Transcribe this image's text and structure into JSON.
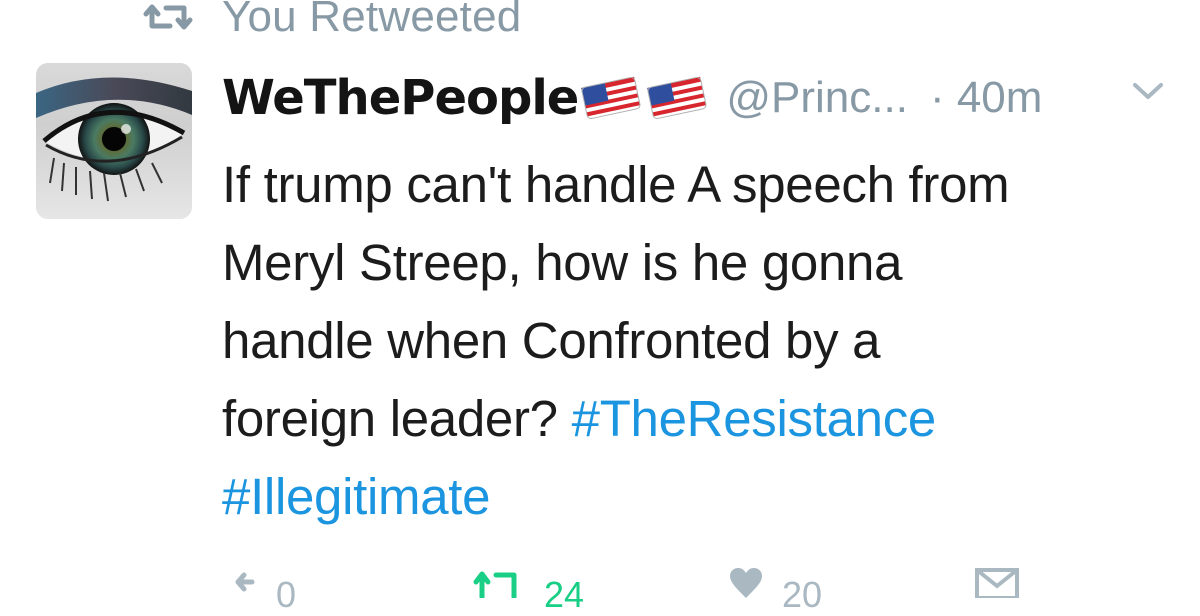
{
  "retweet_context": {
    "label": "You Retweeted",
    "icon": "retweet-icon"
  },
  "author": {
    "display_name": "WeThePeople",
    "flag_emoji": [
      "us-flag",
      "us-flag"
    ],
    "handle": "@Princ...",
    "timestamp": "· 40m",
    "avatar_icon": "avatar-eye-image"
  },
  "tweet": {
    "lines": [
      {
        "text": "If trump can't handle A speech from"
      },
      {
        "text": "Meryl Streep, how is he gonna"
      },
      {
        "text": "handle when Confronted by a"
      },
      {
        "text": "foreign leader? ",
        "hashtag": "#TheResistance"
      },
      {
        "hashtag": "#Illegitimate"
      }
    ]
  },
  "actions": {
    "reply_count": "0",
    "retweet_count": "24",
    "like_count": "20"
  },
  "colors": {
    "text": "#1c1c1c",
    "muted": "#8899a6",
    "hashtag": "#1b95e0",
    "retweet_active": "#19cf86",
    "action_gray": "#aab8c2"
  }
}
